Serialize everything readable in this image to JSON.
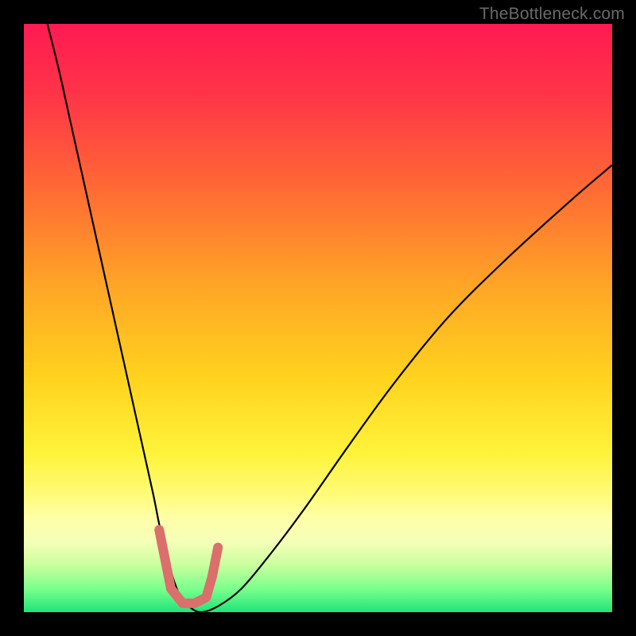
{
  "watermark": "TheBottleneck.com",
  "chart_data": {
    "type": "line",
    "title": "",
    "xlabel": "",
    "ylabel": "",
    "xlim": [
      0,
      100
    ],
    "ylim": [
      0,
      100
    ],
    "grid": false,
    "legend": null,
    "annotations": [],
    "background_gradient_stops": [
      {
        "offset": 0.0,
        "color": "#ff1a52"
      },
      {
        "offset": 0.12,
        "color": "#ff3448"
      },
      {
        "offset": 0.28,
        "color": "#ff6a34"
      },
      {
        "offset": 0.45,
        "color": "#ffa726"
      },
      {
        "offset": 0.6,
        "color": "#ffd21e"
      },
      {
        "offset": 0.73,
        "color": "#fff33a"
      },
      {
        "offset": 0.8,
        "color": "#fffb78"
      },
      {
        "offset": 0.84,
        "color": "#ffffa8"
      },
      {
        "offset": 0.88,
        "color": "#f5ffb8"
      },
      {
        "offset": 0.92,
        "color": "#c9ff9e"
      },
      {
        "offset": 0.96,
        "color": "#7bff8c"
      },
      {
        "offset": 1.0,
        "color": "#20e47a"
      }
    ],
    "series": [
      {
        "name": "bottleneck-curve",
        "color": "#000000",
        "width": 2.2,
        "x": [
          4,
          6,
          8,
          10,
          12,
          14,
          16,
          18,
          20,
          22,
          23,
          24,
          25,
          26,
          27,
          28,
          30,
          33,
          37,
          42,
          48,
          55,
          63,
          72,
          82,
          93,
          100
        ],
        "y": [
          100,
          92,
          83,
          74,
          65,
          56,
          47,
          38,
          29,
          20,
          15,
          11,
          7,
          4,
          2,
          1,
          0,
          1,
          4,
          10,
          18,
          28,
          39,
          50,
          60,
          70,
          76
        ]
      },
      {
        "name": "optimal-marker",
        "color": "#da6f6c",
        "width": 12,
        "linecap": "round",
        "x": [
          23.0,
          24.0,
          25.0,
          27.0,
          29.0,
          31.0,
          32.0,
          33.0
        ],
        "y": [
          14.0,
          9.0,
          4.0,
          1.5,
          1.5,
          2.5,
          6.0,
          11.0
        ]
      }
    ]
  }
}
